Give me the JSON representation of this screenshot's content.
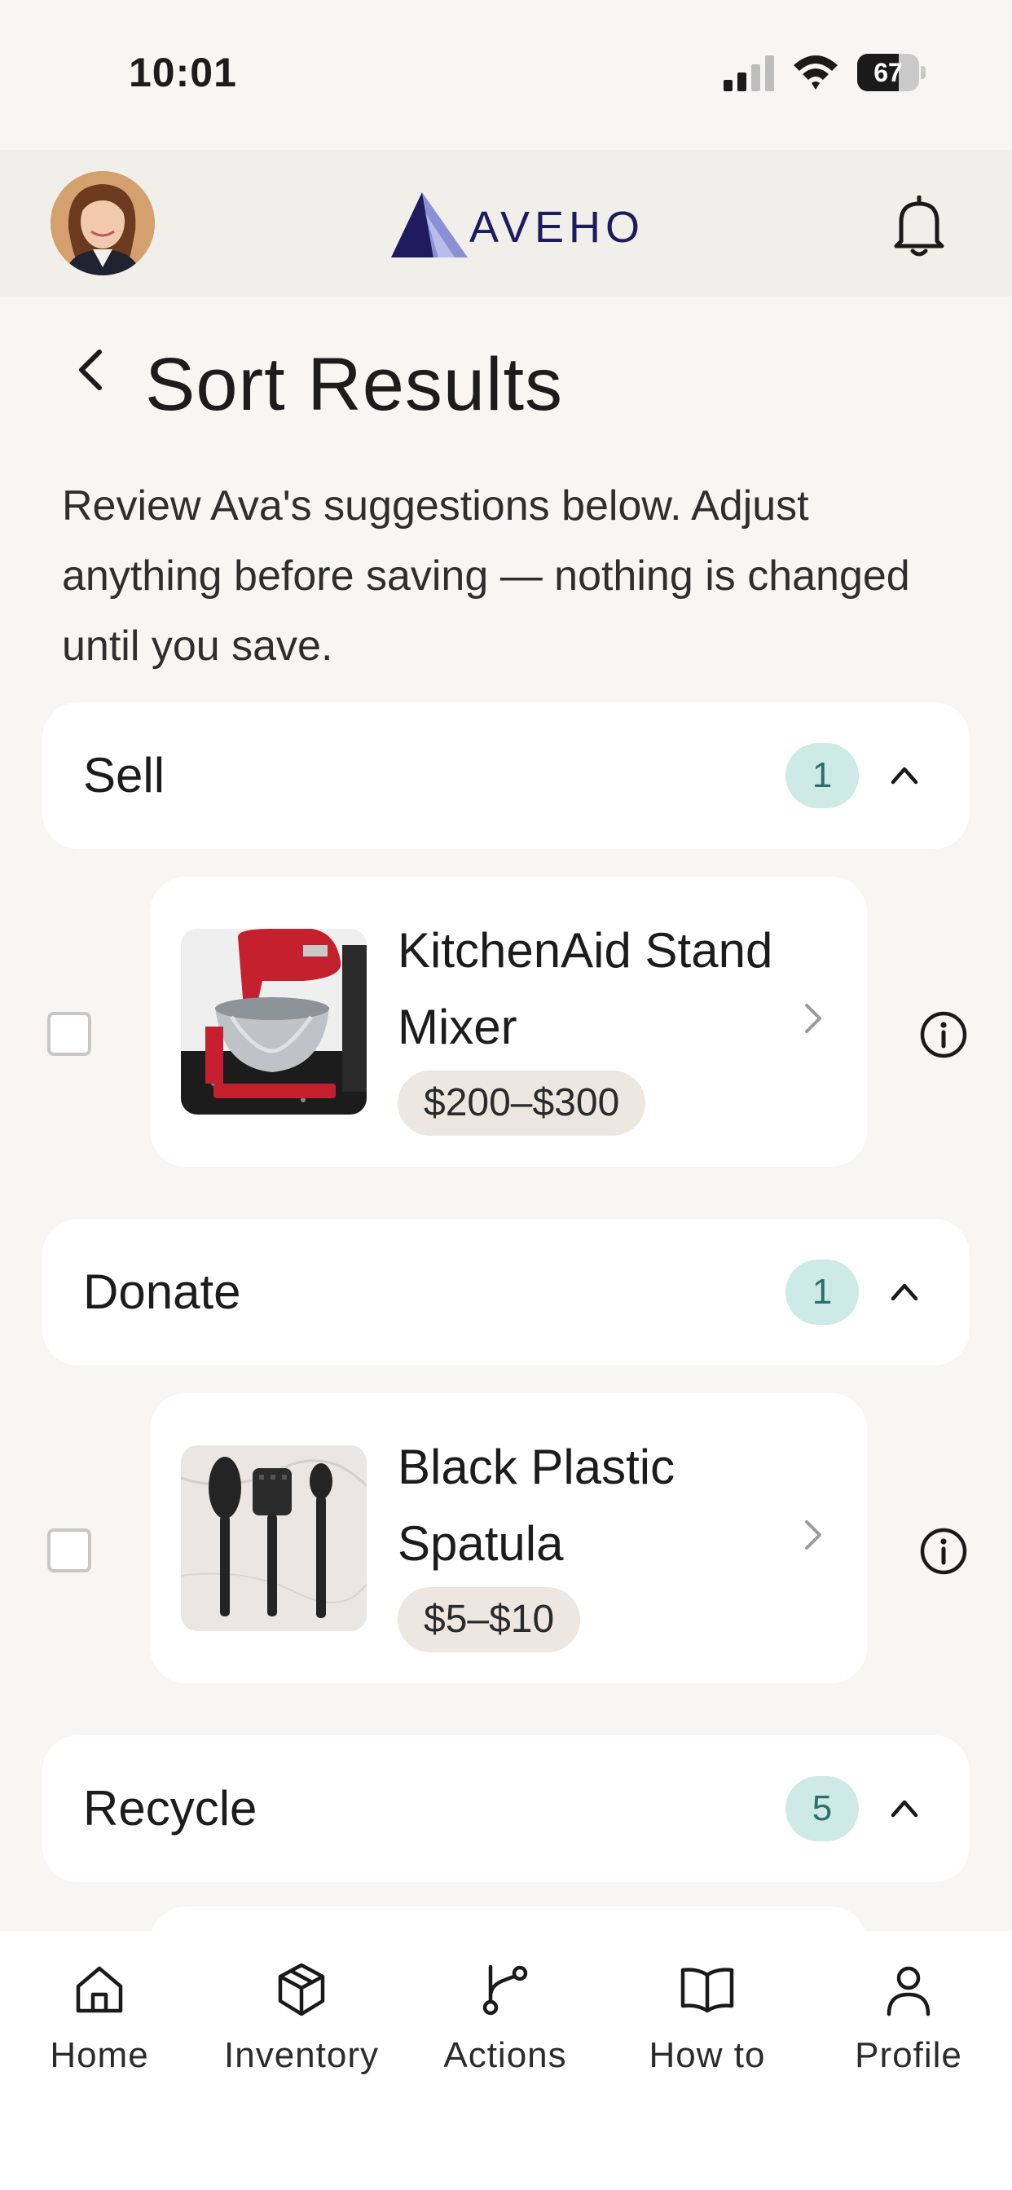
{
  "status": {
    "time": "10:01",
    "battery": "67",
    "battery_level": 0.67
  },
  "header": {
    "logo_text": "AVEHO"
  },
  "page": {
    "title": "Sort Results",
    "description": "Review Ava's suggestions below. Adjust anything before saving — nothing is changed until you save."
  },
  "sections": [
    {
      "label": "Sell",
      "count": "1",
      "items": [
        {
          "name": "KitchenAid Stand Mixer",
          "price": "$200–$300",
          "image": "red-stand-mixer-photo"
        }
      ]
    },
    {
      "label": "Donate",
      "count": "1",
      "items": [
        {
          "name": "Black Plastic Spatula",
          "price": "$5–$10",
          "image": "black-utensils-photo"
        }
      ]
    },
    {
      "label": "Recycle",
      "count": "5",
      "items": []
    }
  ],
  "tabs": [
    {
      "label": "Home",
      "icon": "home-icon"
    },
    {
      "label": "Inventory",
      "icon": "box-icon"
    },
    {
      "label": "Actions",
      "icon": "branch-icon"
    },
    {
      "label": "How to",
      "icon": "book-icon"
    },
    {
      "label": "Profile",
      "icon": "person-icon"
    }
  ],
  "colors": {
    "accent_badge": "#cdeae6",
    "badge_text": "#2e6e69",
    "logo": "#1e1b5e",
    "background": "#f8f6f2"
  }
}
